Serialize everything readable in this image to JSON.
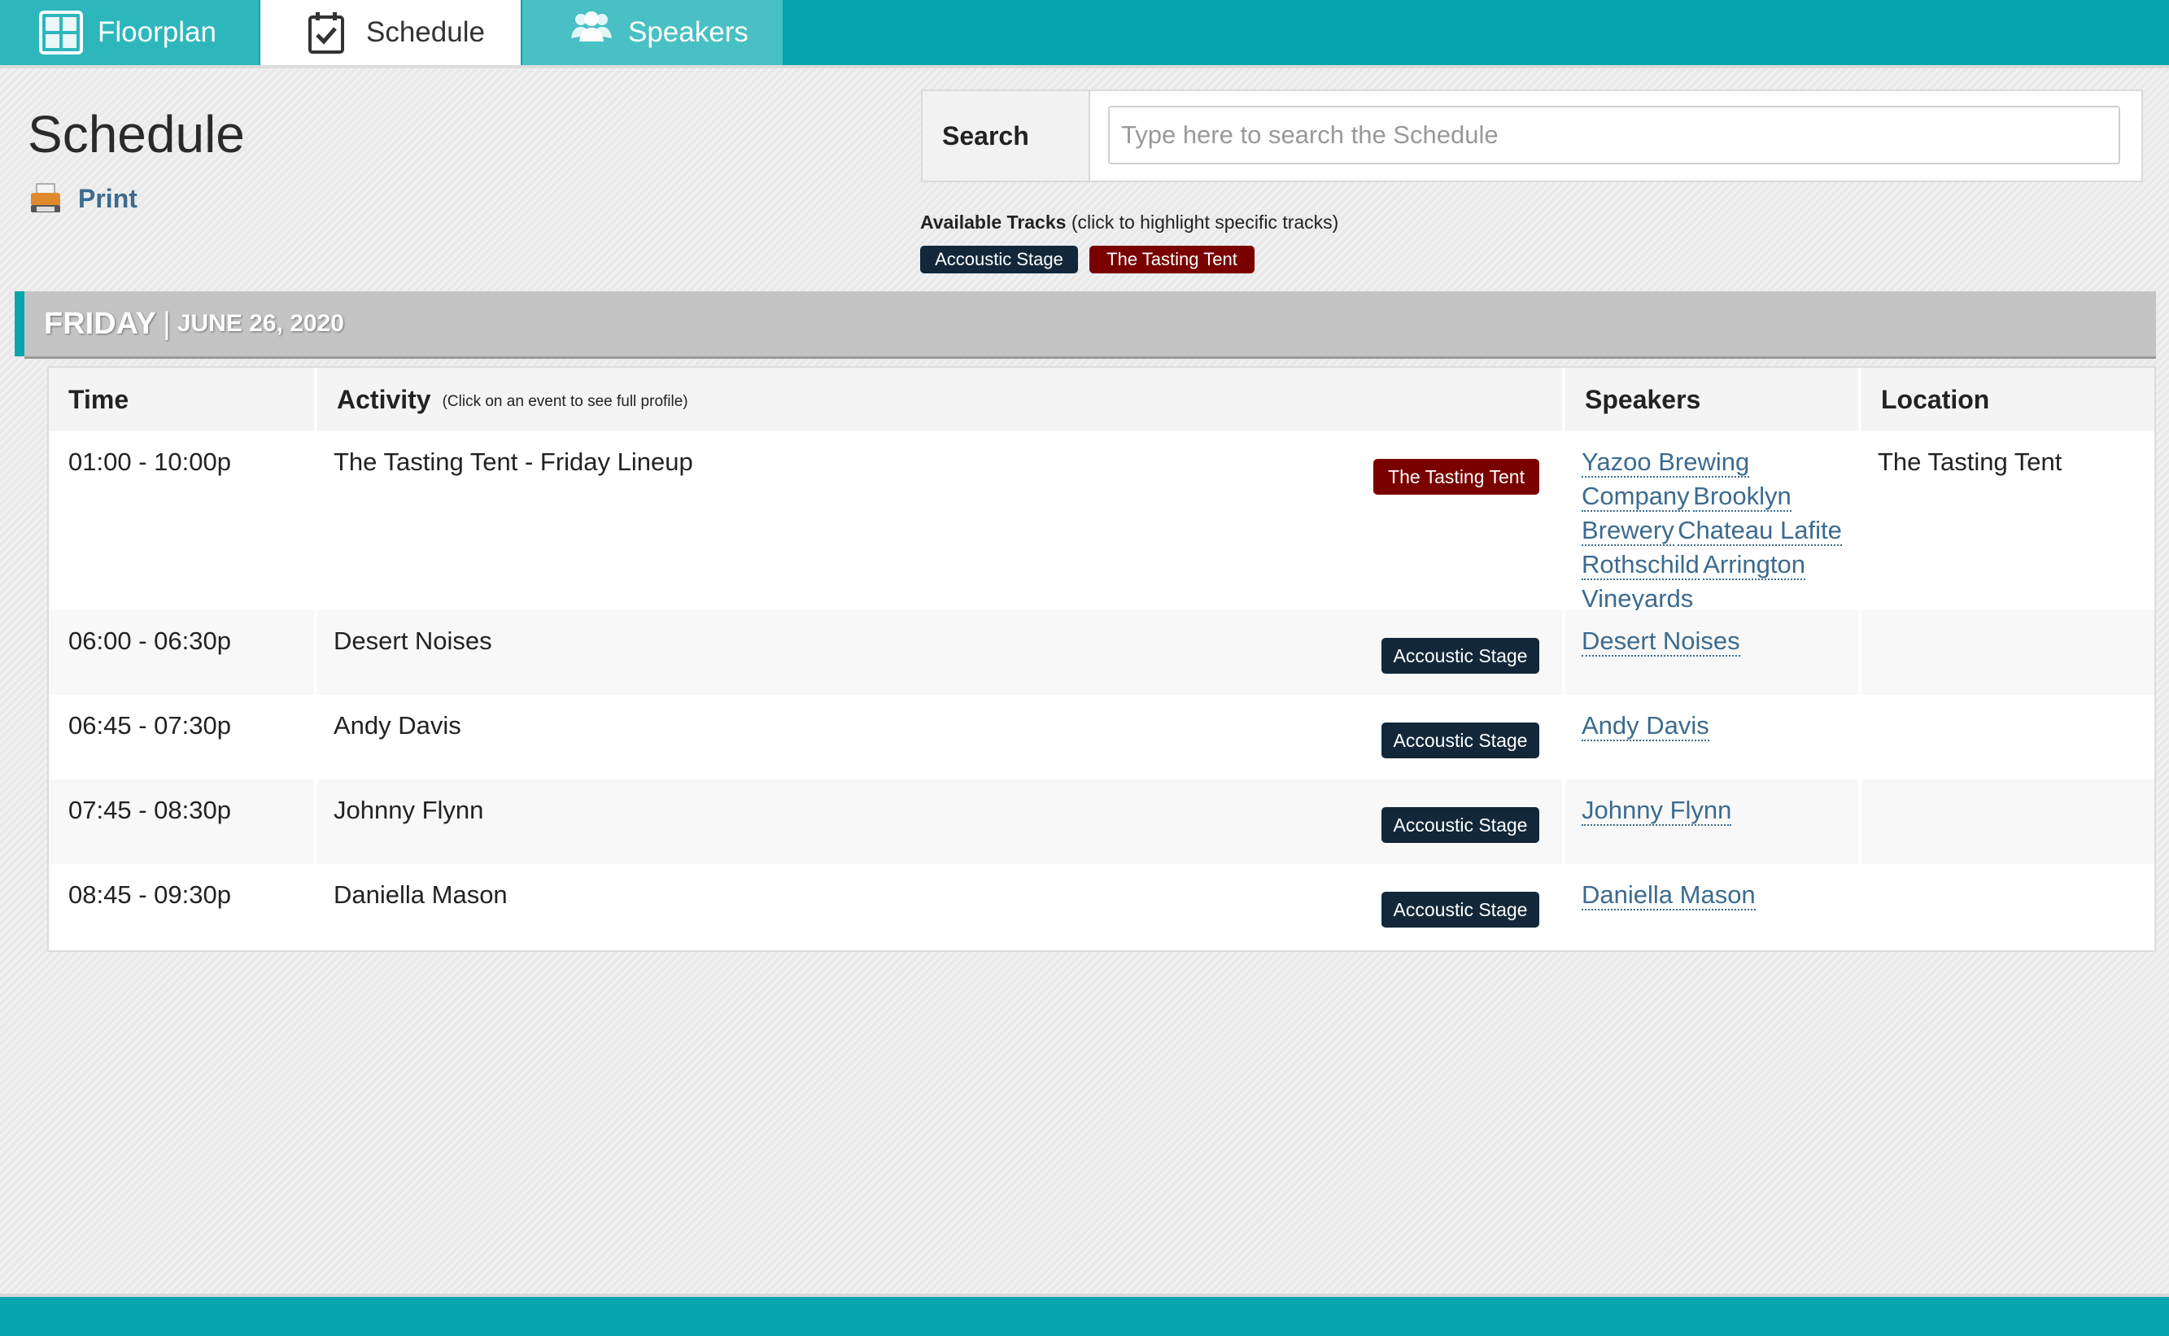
{
  "nav": {
    "tabs": [
      {
        "label": "Floorplan",
        "icon": "floorplan-icon"
      },
      {
        "label": "Schedule",
        "icon": "calendar-check-icon",
        "active": true
      },
      {
        "label": "Speakers",
        "icon": "people-icon"
      }
    ]
  },
  "page": {
    "title": "Schedule",
    "print_label": "Print"
  },
  "search": {
    "label": "Search",
    "placeholder": "Type here to search the Schedule",
    "value": ""
  },
  "tracks": {
    "heading": "Available Tracks",
    "hint": "(click to highlight specific tracks)",
    "items": [
      {
        "label": "Accoustic Stage",
        "color": "#12283a"
      },
      {
        "label": "The Tasting Tent",
        "color": "#7a0000"
      }
    ]
  },
  "day": {
    "weekday": "FRIDAY",
    "separator": "|",
    "date": "JUNE 26, 2020"
  },
  "table": {
    "headers": {
      "time": "Time",
      "activity": "Activity",
      "activity_hint": "(Click on an event to see full profile)",
      "speakers": "Speakers",
      "location": "Location"
    },
    "rows": [
      {
        "time": "01:00 - 10:00p",
        "activity": "The Tasting Tent - Friday Lineup",
        "track": "The Tasting Tent",
        "speakers": [
          "Yazoo Brewing Company",
          "Brooklyn Brewery",
          "Chateau Lafite Rothschild",
          "Arrington Vineyards"
        ],
        "location": "The Tasting Tent"
      },
      {
        "time": "06:00 - 06:30p",
        "activity": "Desert Noises",
        "track": "Accoustic Stage",
        "speakers": [
          "Desert Noises"
        ],
        "location": ""
      },
      {
        "time": "06:45 - 07:30p",
        "activity": "Andy Davis",
        "track": "Accoustic Stage",
        "speakers": [
          "Andy Davis"
        ],
        "location": ""
      },
      {
        "time": "07:45 - 08:30p",
        "activity": "Johnny Flynn",
        "track": "Accoustic Stage",
        "speakers": [
          "Johnny Flynn"
        ],
        "location": ""
      },
      {
        "time": "08:45 - 09:30p",
        "activity": "Daniella Mason",
        "track": "Accoustic Stage",
        "speakers": [
          "Daniella Mason"
        ],
        "location": ""
      }
    ]
  },
  "colors": {
    "brand_teal": "#07a5ad",
    "acoustic_track": "#12283a",
    "tasting_track": "#7a0000",
    "link": "#3c6b8e"
  }
}
